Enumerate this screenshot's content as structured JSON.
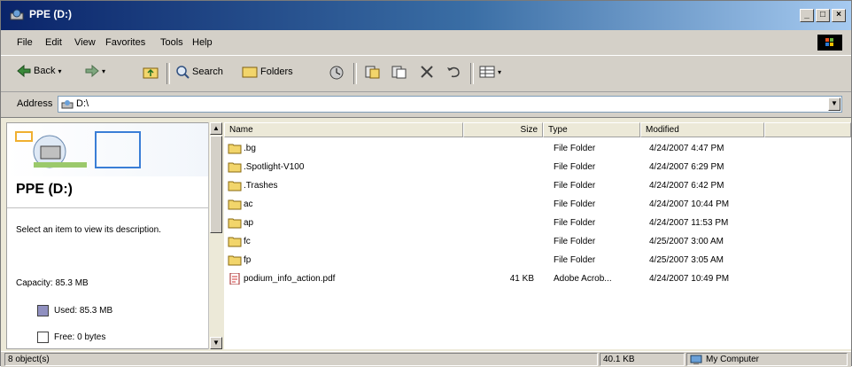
{
  "window": {
    "title": "PPE (D:)",
    "controls": [
      "_",
      "□",
      "×"
    ]
  },
  "menu": [
    "File",
    "Edit",
    "View",
    "Favorites",
    "Tools",
    "Help"
  ],
  "toolbar": {
    "back": "Back",
    "search": "Search",
    "folders": "Folders"
  },
  "address": {
    "label": "Address",
    "value": "D:\\"
  },
  "leftpane": {
    "title": "PPE (D:)",
    "description": "Select an item to view its description.",
    "capacity": "Capacity: 85.3 MB",
    "used": "Used: 85.3 MB",
    "free": "Free: 0 bytes"
  },
  "columns": {
    "name": "Name",
    "size": "Size",
    "type": "Type",
    "modified": "Modified"
  },
  "files": [
    {
      "name": ".bg",
      "size": "",
      "type": "File Folder",
      "modified": "4/24/2007 4:47 PM",
      "icon": "folder-icon"
    },
    {
      "name": ".Spotlight-V100",
      "size": "",
      "type": "File Folder",
      "modified": "4/24/2007 6:29 PM",
      "icon": "folder-icon"
    },
    {
      "name": ".Trashes",
      "size": "",
      "type": "File Folder",
      "modified": "4/24/2007 6:42 PM",
      "icon": "folder-icon"
    },
    {
      "name": "ac",
      "size": "",
      "type": "File Folder",
      "modified": "4/24/2007 10:44 PM",
      "icon": "folder-icon"
    },
    {
      "name": "ap",
      "size": "",
      "type": "File Folder",
      "modified": "4/24/2007 11:53 PM",
      "icon": "folder-icon"
    },
    {
      "name": "fc",
      "size": "",
      "type": "File Folder",
      "modified": "4/25/2007 3:00 AM",
      "icon": "folder-icon"
    },
    {
      "name": "fp",
      "size": "",
      "type": "File Folder",
      "modified": "4/25/2007 3:05 AM",
      "icon": "folder-icon"
    },
    {
      "name": "podium_info_action.pdf",
      "size": "41 KB",
      "type": "Adobe Acrob...",
      "modified": "4/24/2007 10:49 PM",
      "icon": "pdf-icon"
    }
  ],
  "status": {
    "objects": "8 object(s)",
    "size": "40.1 KB",
    "location": "My Computer"
  }
}
